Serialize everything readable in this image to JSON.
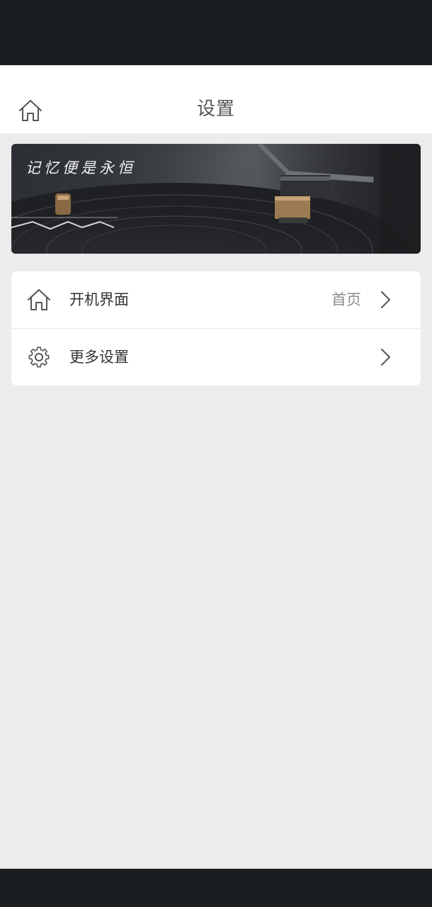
{
  "header": {
    "title": "设置",
    "home_icon": "home-icon"
  },
  "banner": {
    "caption": "记忆便是永恒"
  },
  "settings": {
    "items": [
      {
        "label": "开机界面",
        "value": "首页",
        "icon": "home-icon"
      },
      {
        "label": "更多设置",
        "value": "",
        "icon": "gear-icon"
      }
    ]
  },
  "colors": {
    "status_bar": "#1b1e21",
    "background": "#ececec",
    "card": "#ffffff",
    "title_text": "#555555",
    "value_text": "#8c8c8c"
  }
}
